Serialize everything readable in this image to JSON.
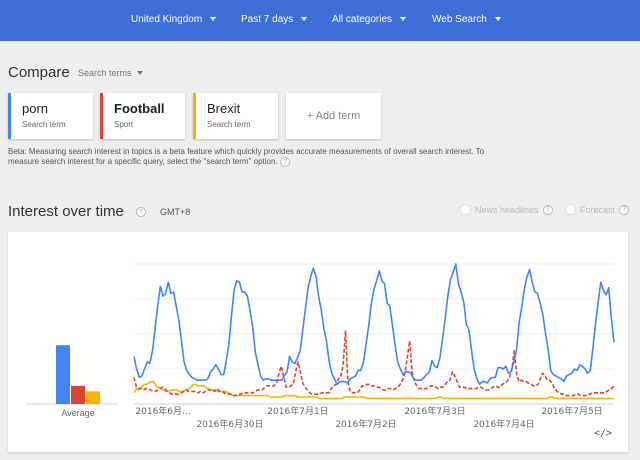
{
  "filters": [
    {
      "label": "United Kingdom"
    },
    {
      "label": "Past 7 days"
    },
    {
      "label": "All categories"
    },
    {
      "label": "Web Search"
    }
  ],
  "compare": {
    "title": "Compare",
    "dropdown_label": "Search terms",
    "terms": [
      {
        "name": "porn",
        "type": "Search term",
        "color": "#4285f4"
      },
      {
        "name": "Football",
        "type": "Sport",
        "color": "#db4437"
      },
      {
        "name": "Brexit",
        "type": "Search term",
        "color": "#f4b400"
      }
    ],
    "add_term_label": "+ Add term",
    "beta_note": "Beta: Measuring search interest in topics is a beta feature which quickly provides accurate measurements of overall search interest. To measure search interest for a specific query, select the \"search term\" option."
  },
  "interest": {
    "title": "Interest over time",
    "timezone": "GMT+8",
    "news_headlines_label": "News headlines",
    "forecast_label": "Forecast",
    "average_label": "Average",
    "embed_icon": "code-embed-icon"
  },
  "chart_data": {
    "type": "line",
    "ylim": [
      0,
      100
    ],
    "grid": true,
    "legend": "none",
    "x_tick_labels": [
      "2016年6月...",
      "2016年6月30日",
      "2016年7月1日",
      "2016年7月2日",
      "2016年7月3日",
      "2016年7月4日",
      "2016年7月5日"
    ],
    "averages": [
      {
        "series": "porn",
        "value": 42,
        "color": "#4285f4"
      },
      {
        "series": "Football",
        "value": 13,
        "color": "#db4437"
      },
      {
        "series": "Brexit",
        "value": 9,
        "color": "#f4b400"
      }
    ],
    "series": [
      {
        "name": "porn",
        "color": "#4285f4",
        "style": "solid",
        "values": [
          34,
          25,
          19,
          20,
          25,
          30,
          29,
          38,
          54,
          70,
          84,
          77,
          79,
          87,
          79,
          80,
          70,
          60,
          45,
          30,
          24,
          21,
          19,
          18,
          17,
          17,
          17,
          17,
          18,
          23,
          25,
          28,
          25,
          21,
          21,
          31,
          43,
          64,
          82,
          88,
          87,
          80,
          80,
          77,
          67,
          55,
          37,
          28,
          20,
          17,
          18,
          18,
          17,
          17,
          17,
          17,
          17,
          20,
          23,
          34,
          30,
          29,
          33,
          38,
          53,
          68,
          83,
          91,
          97,
          91,
          77,
          67,
          54,
          45,
          30,
          22,
          18,
          14,
          16,
          16,
          16,
          15,
          18,
          19,
          20,
          24,
          24,
          30,
          43,
          56,
          72,
          82,
          88,
          95,
          88,
          86,
          72,
          70,
          56,
          42,
          30,
          25,
          21,
          23,
          23,
          22,
          18,
          17,
          17,
          17,
          19,
          21,
          23,
          31,
          27,
          26,
          33,
          47,
          61,
          77,
          89,
          94,
          100,
          86,
          80,
          73,
          57,
          53,
          38,
          25,
          18,
          14,
          16,
          16,
          15,
          18,
          19,
          19,
          26,
          26,
          25,
          27,
          22,
          23,
          30,
          38,
          58,
          69,
          82,
          91,
          96,
          87,
          80,
          79,
          72,
          64,
          51,
          39,
          24,
          21,
          20,
          19,
          18,
          16,
          20,
          21,
          22,
          25,
          24,
          28,
          27,
          25,
          22,
          24,
          40,
          57,
          73,
          87,
          81,
          78,
          83,
          61,
          44
        ]
      },
      {
        "name": "Football",
        "color": "#db4437",
        "style": "dashed",
        "values": [
          19,
          12,
          11,
          11,
          10,
          11,
          11,
          10,
          9,
          9,
          10,
          11,
          12,
          11,
          9,
          8,
          7,
          7,
          7,
          7,
          8,
          9,
          10,
          9,
          9,
          9,
          9,
          8,
          9,
          8,
          9,
          10,
          10,
          10,
          9,
          11,
          9,
          9,
          8,
          7,
          7,
          7,
          6,
          6,
          7,
          7,
          8,
          8,
          8,
          8,
          8,
          9,
          10,
          10,
          10,
          12,
          13,
          13,
          13,
          13,
          15,
          22,
          27,
          20,
          12,
          12,
          13,
          14,
          23,
          30,
          23,
          15,
          12,
          10,
          8,
          7,
          7,
          7,
          7,
          8,
          8,
          8,
          8,
          11,
          13,
          14,
          18,
          19,
          28,
          52,
          16,
          9,
          8,
          8,
          8,
          10,
          13,
          13,
          14,
          14,
          13,
          13,
          12,
          12,
          11,
          10,
          10,
          11,
          11,
          10,
          11,
          12,
          14,
          17,
          22,
          33,
          45,
          23,
          16,
          13,
          11,
          11,
          11,
          11,
          12,
          13,
          13,
          12,
          11,
          12,
          12,
          14,
          16,
          17,
          23,
          20,
          16,
          12,
          12,
          12,
          11,
          11,
          11,
          11,
          11,
          12,
          12,
          11,
          10,
          10,
          11,
          12,
          13,
          12,
          12,
          14,
          15,
          16,
          19,
          24,
          38,
          22,
          16,
          17,
          16,
          16,
          15,
          14,
          13,
          13,
          14,
          18,
          22,
          20,
          17,
          17,
          15,
          11,
          9,
          8,
          7,
          7,
          6,
          6,
          6,
          6,
          7,
          7,
          6,
          6,
          6,
          7,
          7,
          8,
          8,
          8,
          8,
          8,
          8,
          9,
          10,
          11,
          13
        ]
      },
      {
        "name": "Brexit",
        "color": "#f4b400",
        "style": "solid",
        "values": [
          8,
          11,
          10,
          12,
          14,
          14,
          15,
          16,
          16,
          13,
          12,
          11,
          10,
          9,
          9,
          10,
          10,
          10,
          9,
          9,
          9,
          10,
          11,
          12,
          14,
          14,
          13,
          13,
          13,
          12,
          11,
          10,
          10,
          10,
          9,
          9,
          9,
          9,
          8,
          7,
          6,
          6,
          6,
          6,
          6,
          6,
          6,
          6,
          6,
          6,
          6,
          6,
          6,
          6,
          6,
          5,
          5,
          5,
          5,
          5,
          5,
          6,
          6,
          6,
          6,
          6,
          5,
          5,
          5,
          5,
          5,
          5,
          5,
          5,
          5,
          4,
          4,
          4,
          4,
          4,
          4,
          4,
          4,
          4,
          4,
          5,
          5,
          5,
          5,
          5,
          5,
          5,
          5,
          5,
          4,
          4,
          4,
          4,
          4,
          4,
          4,
          4,
          4,
          4,
          4,
          4,
          4,
          4,
          4,
          4,
          4,
          4,
          4,
          4,
          4,
          4,
          4,
          4,
          4,
          4,
          4,
          4,
          4,
          5,
          5,
          4,
          4,
          4,
          4,
          4,
          4,
          4,
          4,
          4,
          4,
          4,
          4,
          4,
          4,
          4,
          4,
          4,
          4,
          4,
          4,
          4,
          4,
          4,
          4,
          4,
          4,
          4,
          4,
          4,
          4,
          4,
          4,
          4,
          4,
          4,
          4,
          4,
          4,
          4,
          4,
          4,
          4,
          4,
          5,
          5,
          4,
          4,
          4,
          4,
          4,
          4,
          4,
          4,
          4,
          4,
          4,
          4,
          4,
          4,
          4,
          4,
          4,
          4,
          4,
          4,
          4,
          4,
          4,
          4,
          4
        ]
      }
    ]
  }
}
